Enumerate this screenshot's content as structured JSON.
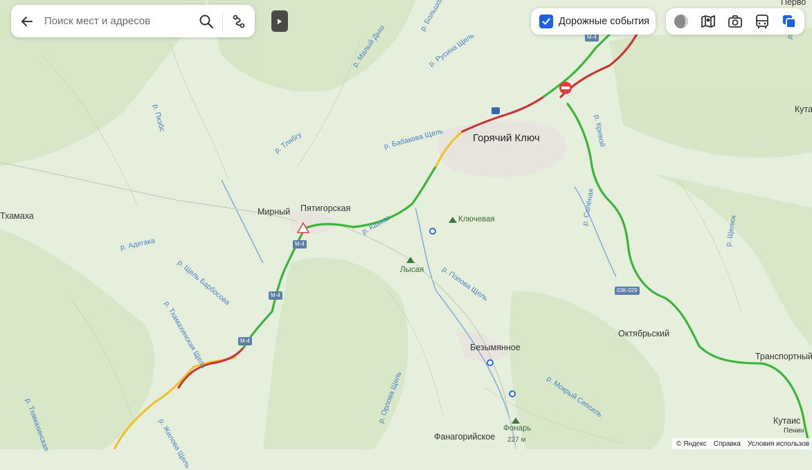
{
  "search": {
    "placeholder": "Поиск мест и адресов"
  },
  "traffic": {
    "label": "Дорожные события",
    "checked": true,
    "accent": "#1e5fe6"
  },
  "layers": [
    "palette-icon",
    "map-layers-icon",
    "panorama-icon",
    "transit-icon",
    "layers-stack-icon"
  ],
  "map": {
    "cities": [
      {
        "id": "goryachiy-klyuch",
        "name": "Горячий Ключ"
      }
    ],
    "towns": [
      {
        "id": "mirny",
        "name": "Мирный"
      },
      {
        "id": "pyatigorskaya",
        "name": "Пятигорская"
      },
      {
        "id": "tkhamakha",
        "name": "Тхамаха"
      },
      {
        "id": "bezymyannoe",
        "name": "Безымянное"
      },
      {
        "id": "oktyabrsky",
        "name": "Октябрьский"
      },
      {
        "id": "transportny",
        "name": "Транспортный"
      },
      {
        "id": "kutais",
        "name": "Кутаис"
      },
      {
        "id": "kuta-edge",
        "name": "Кута"
      },
      {
        "id": "fanagoriyskoe",
        "name": "Фанагорийское"
      },
      {
        "id": "pervo-edge",
        "name": "Перво"
      },
      {
        "id": "penin-edge",
        "name": "Пенин"
      }
    ],
    "peaks": [
      {
        "id": "klyuchevaya",
        "name": "Ключевая"
      },
      {
        "id": "lysaya",
        "name": "Лысая"
      },
      {
        "id": "fonar",
        "name": "Фонарь",
        "elevation": "227 м"
      }
    ],
    "rivers": [
      "р. Пкэбс",
      "р. Тлябгу",
      "р. Бабакова Щель",
      "р. Малый Дыш",
      "р. Русина Щель",
      "р. Большой",
      "р. Кавказ",
      "р. Адегака",
      "р. Щель Барбосова",
      "р. Тхамахинская Щель",
      "р. Попова Щель",
      "р. Орлова Щель",
      "р. Мокрый Сепсиль",
      "р. Солёная",
      "р. Кривой",
      "р. Щелюк",
      "р. Тхамахинская",
      "р. Жилова Щель",
      "р. Габорк"
    ],
    "routes": [
      "М-4",
      "М-4",
      "М-4",
      "М-4",
      "03К-029"
    ],
    "colors": {
      "land": "#e6efdc",
      "forest": "#d7e6c8",
      "urban": "#e9e7e2",
      "road_free": "#3cb43c",
      "road_slow": "#f0c030",
      "road_jam": "#c8373c",
      "water": "#4a7fc0"
    }
  },
  "footer": {
    "copyright": "© Яндекс",
    "help": "Справка",
    "terms": "Условия использов"
  }
}
